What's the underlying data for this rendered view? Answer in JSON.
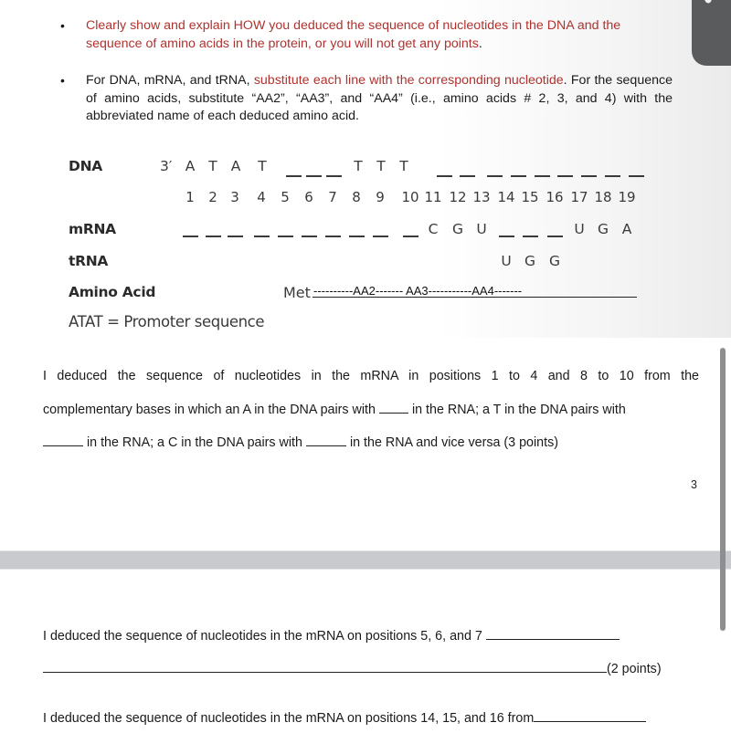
{
  "instructions": {
    "bullet_1_red": "Clearly show and explain HOW you deduced the sequence of nucleotides in the DNA and the sequence of amino acids in the protein, or you will not get any points",
    "bullet_1_end": ".",
    "bullet_2_prefix": "For DNA, mRNA, and tRNA, ",
    "bullet_2_red": "substitute each line with the corresponding nucleotide",
    "bullet_2_suffix": ". For the sequence of amino acids, substitute “AA2”, “AA3”, and “AA4” (i.e., amino acids # 2, 3, and 4) with the abbreviated name of each deduced amino acid."
  },
  "sequence_table": {
    "labels": {
      "dna": "DNA",
      "mrna": "mRNA",
      "trna": "tRNA",
      "amino_acid": "Amino Acid"
    },
    "dna_prefix": "3′",
    "dna": [
      "A",
      "T",
      "A",
      "T",
      "_",
      "_",
      "_",
      "T",
      "T",
      "T",
      "_",
      "_",
      "_",
      "_",
      "_",
      "_",
      "_",
      "_",
      "_"
    ],
    "positions": [
      "1",
      "2",
      "3",
      "4",
      "5",
      "6",
      "7",
      "8",
      "9",
      "10",
      "11",
      "12",
      "13",
      "14",
      "15",
      "16",
      "17",
      "18",
      "19"
    ],
    "mrna": [
      "_",
      "_",
      "_",
      "_",
      "_",
      "_",
      "_",
      "_",
      "_",
      "_",
      "C",
      "G",
      "U",
      "_",
      "_",
      "_",
      "U",
      "G",
      "A"
    ],
    "trna": [
      "",
      "",
      "",
      "",
      "",
      "",
      "",
      "",
      "",
      "",
      "",
      "",
      "",
      "U",
      "G",
      "G",
      "",
      "",
      ""
    ],
    "amino_acid_start": "Met",
    "amino_acid_line": "----------AA2------- AA3-----------AA4-------",
    "promoter_note": "ATAT = Promoter sequence"
  },
  "answer_1": {
    "line_1": "I deduced the sequence of nucleotides in the mRNA in positions 1 to 4 and 8 to 10 from the",
    "line_2a": "complementary bases in which an A in the DNA pairs with",
    "line_2b": "in the RNA; a T in the DNA pairs with",
    "line_3a": "in the RNA; a C in the DNA pairs with",
    "line_3b": "in the RNA and vice versa (3 points)"
  },
  "page_number": "3",
  "answer_2": {
    "line_1": "I deduced the sequence of nucleotides in the mRNA on positions 5, 6, and 7",
    "points": "(2 points)"
  },
  "answer_3": {
    "line_1": "I deduced the sequence of nucleotides in the mRNA on positions 14, 15, and 16 from"
  }
}
